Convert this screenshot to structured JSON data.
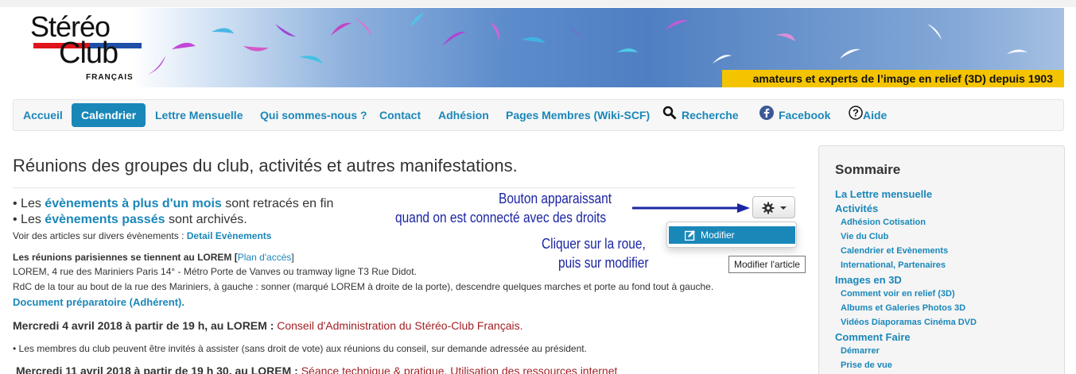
{
  "banner": {
    "logo_line1": "Stéréo",
    "logo_line2": "Club",
    "logo_sub": "FRANÇAIS",
    "tagline": "amateurs et experts de l’image en relief (3D) depuis 1903"
  },
  "nav": {
    "items": [
      {
        "label": "Accueil",
        "active": false
      },
      {
        "label": "Calendrier",
        "active": true
      },
      {
        "label": "Lettre Mensuelle",
        "active": false
      },
      {
        "label": "Qui sommes-nous ?",
        "active": false
      },
      {
        "label": "Contact",
        "active": false
      },
      {
        "label": "Adhésion",
        "active": false
      },
      {
        "label": "Pages Membres (Wiki-SCF)",
        "active": false
      },
      {
        "label": "Recherche",
        "icon": "search-icon"
      },
      {
        "label": "Facebook",
        "icon": "facebook-icon"
      },
      {
        "label": "Aide",
        "icon": "help-icon"
      }
    ]
  },
  "main": {
    "title": "Réunions des groupes du club, activités et autres manifestations.",
    "bullet1_pre": "• Les ",
    "bullet1_link": "évènements à plus d'un mois",
    "bullet1_post": " sont retracés en fin",
    "bullet2_pre": "• Les ",
    "bullet2_link": "évènements passés",
    "bullet2_post": " sont archivés.",
    "articles_pre": "Voir des articles sur divers évènements : ",
    "articles_link": "Detail Evènements",
    "meeting_pre": "Les réunions parisiennes se tiennent au LOREM [",
    "meeting_link": "Plan d'accès",
    "meeting_post": "]",
    "address": "LOREM, 4 rue des Mariniers  Paris 14° - Métro Porte de Vanves ou tramway ligne T3 Rue Didot.",
    "directions": "RdC de la tour au bout de la rue des Mariniers, à gauche : sonner (marqué LOREM à droite de la porte), descendre quelques marches et porte au fond tout à gauche.",
    "doc_link": "Document préparatoire (Adhérent).",
    "event1_date": "Mercredi 4 avril 2018 à partir de 19 h, au LOREM : ",
    "event1_title": "Conseil d'Administration du Stéréo-Club Français.",
    "event1_note": "• Les membres du club peuvent être invités à assister (sans droit de vote) aux réunions du conseil, sur demande adressée au président.",
    "event2_date": "Mercredi 11 avril 2018 à partir de 19 h 30, au LOREM : ",
    "event2_title": "Séance technique & pratique. Utilisation des ressources internet"
  },
  "edit_controls": {
    "gear_icon": "gear-icon",
    "dropdown_item": "Modifier",
    "tooltip": "Modifier l'article"
  },
  "annotations": {
    "line1": "Bouton apparaissant",
    "line2": "quand on est connecté avec des droits",
    "line3": "Cliquer sur la roue,",
    "line4": "puis sur modifier",
    "color": "#1b25a3"
  },
  "sidebar": {
    "title": "Sommaire",
    "groups": [
      {
        "label": "La Lettre mensuelle",
        "items": []
      },
      {
        "label": "Activités",
        "items": [
          "Adhésion Cotisation",
          "Vie du Club",
          "Calendrier et Evènements",
          "International, Partenaires"
        ]
      },
      {
        "label": "Images en 3D",
        "items": [
          "Comment voir en relief (3D)",
          "Albums et Galeries Photos 3D",
          "Vidéos Diaporamas Cinéma DVD"
        ]
      },
      {
        "label": "Comment Faire",
        "items": [
          "Démarrer",
          "Prise de vue"
        ]
      }
    ]
  },
  "colors": {
    "accent": "#1a87b9",
    "event_title": "#a31f24",
    "tagline_bg": "#f5c400"
  }
}
